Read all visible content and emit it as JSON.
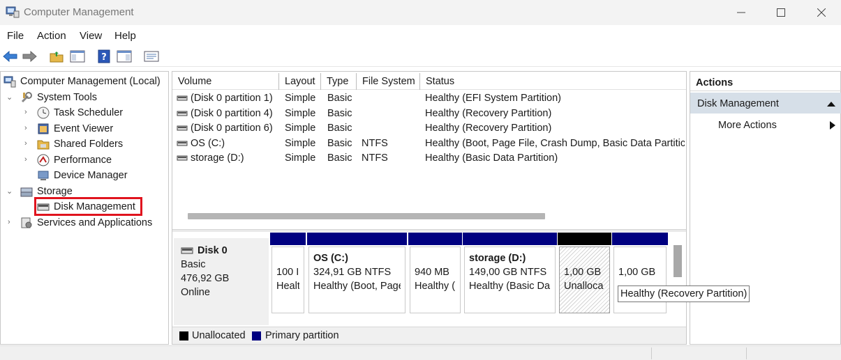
{
  "window": {
    "title": "Computer Management"
  },
  "menu": [
    "File",
    "Action",
    "View",
    "Help"
  ],
  "toolbar_icons": [
    "back-icon",
    "forward-icon",
    "up-folder-icon",
    "show-hide-console-tree-icon",
    "help-icon",
    "show-hide-action-pane-icon",
    "properties-icon"
  ],
  "tree": {
    "root": "Computer Management (Local)",
    "system_tools": "System Tools",
    "task_scheduler": "Task Scheduler",
    "event_viewer": "Event Viewer",
    "shared_folders": "Shared Folders",
    "performance": "Performance",
    "device_manager": "Device Manager",
    "storage": "Storage",
    "disk_management": "Disk Management",
    "services": "Services and Applications"
  },
  "volumes": {
    "headers": [
      "Volume",
      "Layout",
      "Type",
      "File System",
      "Status"
    ],
    "rows": [
      [
        "(Disk 0 partition 1)",
        "Simple",
        "Basic",
        "",
        "Healthy (EFI System Partition)"
      ],
      [
        "(Disk 0 partition 4)",
        "Simple",
        "Basic",
        "",
        "Healthy (Recovery Partition)"
      ],
      [
        "(Disk 0 partition 6)",
        "Simple",
        "Basic",
        "",
        "Healthy (Recovery Partition)"
      ],
      [
        "OS (C:)",
        "Simple",
        "Basic",
        "NTFS",
        "Healthy (Boot, Page File, Crash Dump, Basic Data Partitic"
      ],
      [
        "storage (D:)",
        "Simple",
        "Basic",
        "NTFS",
        "Healthy (Basic Data Partition)"
      ]
    ]
  },
  "disk": {
    "name": "Disk 0",
    "type": "Basic",
    "size": "476,92 GB",
    "state": "Online",
    "partitions": [
      {
        "title": "",
        "size": "100 I",
        "status": "Healt",
        "kind": "primary"
      },
      {
        "title": "OS  (C:)",
        "size": "324,91 GB NTFS",
        "status": "Healthy (Boot, Page",
        "kind": "primary"
      },
      {
        "title": "",
        "size": "940 MB",
        "status": "Healthy (",
        "kind": "primary"
      },
      {
        "title": "storage  (D:)",
        "size": "149,00 GB NTFS",
        "status": "Healthy (Basic Da",
        "kind": "primary"
      },
      {
        "title": "",
        "size": "1,00 GB",
        "status": "Unalloca",
        "kind": "unallocated"
      },
      {
        "title": "",
        "size": "1,00 GB",
        "status": "",
        "kind": "primary"
      }
    ]
  },
  "legend": {
    "unallocated": "Unallocated",
    "primary": "Primary partition"
  },
  "colors": {
    "primary": "#000080",
    "unallocated": "#000000",
    "highlight": "#e0141e",
    "actions_section": "#d6dfe8"
  },
  "actions": {
    "title": "Actions",
    "section": "Disk Management",
    "more": "More Actions"
  },
  "tooltip": "Healthy (Recovery Partition)"
}
